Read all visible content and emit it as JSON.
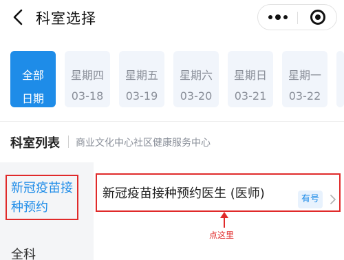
{
  "header": {
    "title": "科室选择",
    "back_icon": "back-chevron-icon",
    "more_icon": "more-dots-icon",
    "close_icon": "target-circle-icon"
  },
  "dates": [
    {
      "week": "全部",
      "date": "日期",
      "active": true
    },
    {
      "week": "星期四",
      "date": "03-18",
      "active": false
    },
    {
      "week": "星期五",
      "date": "03-19",
      "active": false
    },
    {
      "week": "星期六",
      "date": "03-20",
      "active": false
    },
    {
      "week": "星期日",
      "date": "03-21",
      "active": false
    },
    {
      "week": "星期一",
      "date": "03-22",
      "active": false
    }
  ],
  "section": {
    "title": "科室列表",
    "subtitle": "商业文化中心社区健康服务中心"
  },
  "departments": [
    {
      "label": "新冠疫苗接种预约",
      "active": true
    },
    {
      "label": "全科",
      "active": false
    }
  ],
  "doctors": [
    {
      "name": "新冠疫苗接种预约医生 (医师)",
      "badge": "有号"
    }
  ],
  "annotation": {
    "note": "点这里",
    "color": "#e02a2a"
  },
  "colors": {
    "accent": "#1e8ce8",
    "tab_bg": "#f1f5fb",
    "panel_bg": "#f4f5f7"
  }
}
